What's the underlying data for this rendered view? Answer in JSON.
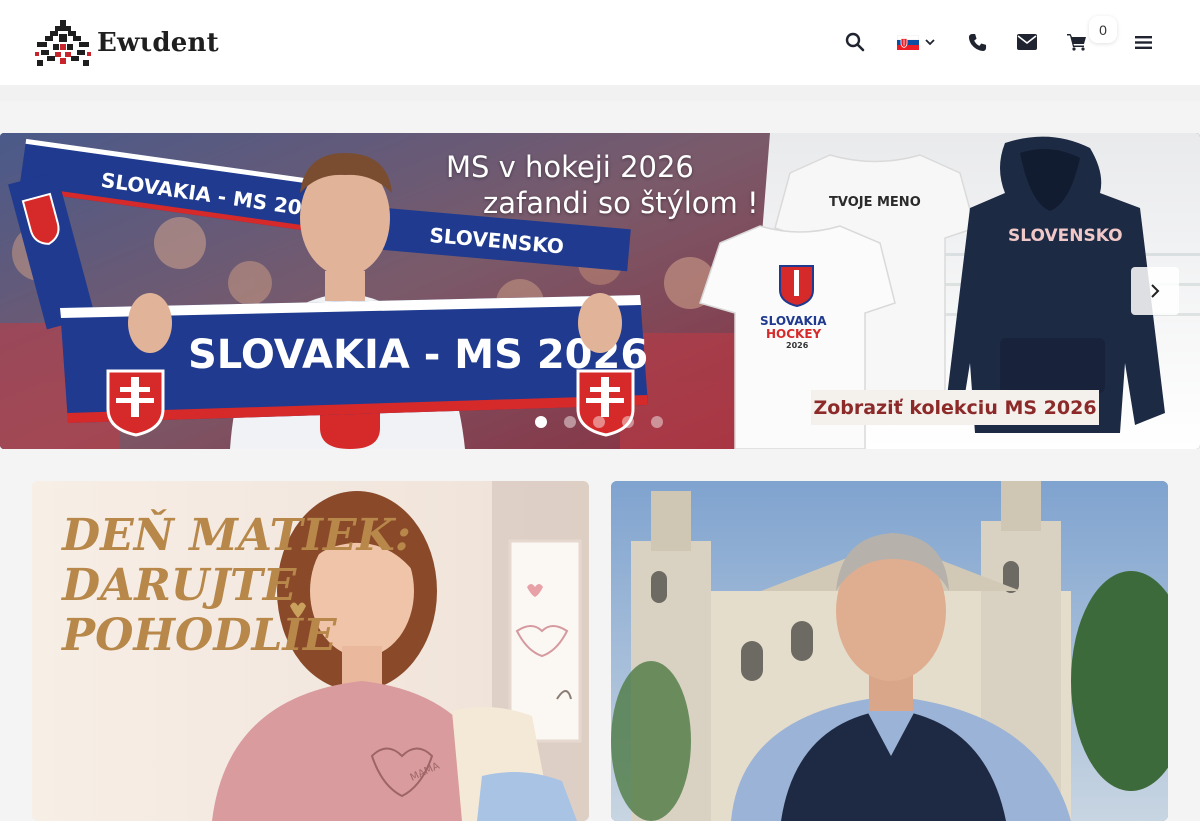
{
  "header": {
    "logo_text": "Ewιdent",
    "cart_count": "0",
    "icons": [
      "search-icon",
      "flag-sk-icon",
      "chevron-down-icon",
      "phone-icon",
      "envelope-icon",
      "cart-icon",
      "menu-icon"
    ]
  },
  "hero": {
    "title": "MS v hokeji 2026",
    "subtitle": "zafandi so štýlom !",
    "cta_label": "Zobraziť kolekciu MS 2026",
    "scarf_text": "SLOVAKIA - MS 2026",
    "scarf_text_small": "SLOVAKIA - MS 2026",
    "scarf_text_back": "SLOVENSKO",
    "tshirt_name": "TVOJE MENO",
    "tshirt_logo_line1": "SLOVAKIA",
    "tshirt_logo_line2": "HOCKEY",
    "tshirt_logo_year": "2026",
    "hoodie_text": "SLOVENSKO",
    "slides_total": 5,
    "active_slide": 1
  },
  "banners": {
    "left": {
      "line1": "DEŇ MATIEK:",
      "line2": "DARUJTE",
      "line3": "POHODLIE",
      "shirt_print": "MAMA"
    }
  },
  "colors": {
    "header_bg": "#ffffff",
    "page_bg": "#f4f4f5",
    "cta_text": "#8c2a2a",
    "mothers_text": "#b8884a",
    "scarf_blue": "#1f3a8f"
  }
}
